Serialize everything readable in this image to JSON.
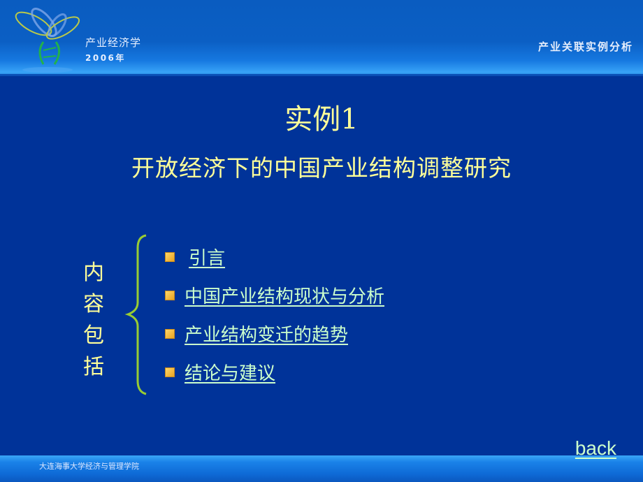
{
  "header": {
    "org_title": "产业经济学",
    "org_year": "2006年",
    "section_title": "产业关联实例分析",
    "logo_icon": "dragonfly-logo-icon"
  },
  "main": {
    "title": "实例1",
    "subtitle": "开放经济下的中国产业结构调整研究",
    "vertical_label": [
      "内",
      "容",
      "包",
      "括"
    ],
    "toc_items": [
      {
        "label": "引言"
      },
      {
        "label": "中国产业结构现状与分析"
      },
      {
        "label": "产业结构变迁的趋势"
      },
      {
        "label": "结论与建议"
      }
    ],
    "bullet_icon": "square-bullet-icon"
  },
  "nav": {
    "back_label": "back"
  },
  "footer": {
    "text": "大连海事大学经济与管理学院"
  },
  "colors": {
    "background": "#003399",
    "title": "#ffff99",
    "link": "#ccffcc",
    "brace": "#99cc33",
    "bullet": "#f0b33a"
  }
}
